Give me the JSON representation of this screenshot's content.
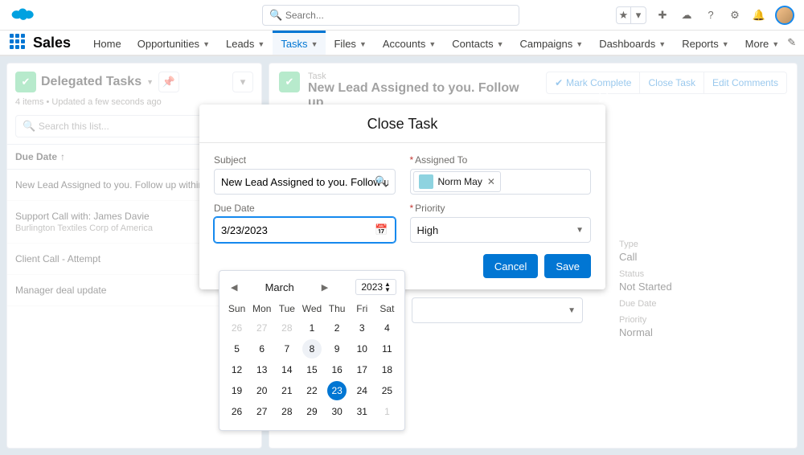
{
  "global": {
    "search_placeholder": "Search...",
    "app_name": "Sales"
  },
  "nav": {
    "items": [
      "Home",
      "Opportunities",
      "Leads",
      "Tasks",
      "Files",
      "Accounts",
      "Contacts",
      "Campaigns",
      "Dashboards",
      "Reports",
      "More"
    ],
    "active": "Tasks"
  },
  "left": {
    "title": "Delegated Tasks",
    "meta": "4 items • Updated a few seconds ago",
    "search_placeholder": "Search this list...",
    "sort_col": "Due Date",
    "rows": [
      {
        "title": "New Lead Assigned to you. Follow up within 2",
        "sub": ""
      },
      {
        "title": "Support Call with: James Davie",
        "sub": "Burlington Textiles Corp of America"
      },
      {
        "title": "Client Call - Attempt",
        "sub": ""
      },
      {
        "title": "Manager deal update",
        "sub": ""
      }
    ]
  },
  "right": {
    "kicker": "Task",
    "title": "New Lead Assigned to you. Follow up",
    "actions": {
      "complete": "Mark Complete",
      "close": "Close Task",
      "edit": "Edit Comments"
    },
    "details": {
      "type_label": "Type",
      "type_val": "Call",
      "status_label": "Status",
      "status_val": "Not Started",
      "due_label": "Due Date",
      "due_val": "",
      "priority_label": "Priority",
      "priority_val": "Normal"
    }
  },
  "modal": {
    "title": "Close Task",
    "close_x": "✕",
    "subject_label": "Subject",
    "subject_val": "New Lead Assigned to you. Follow u",
    "assigned_label": "Assigned To",
    "assigned_name": "Norm May",
    "due_label": "Due Date",
    "due_val": "3/23/2023",
    "priority_label": "Priority",
    "priority_val": "High",
    "cancel": "Cancel",
    "save": "Save"
  },
  "datepicker": {
    "month": "March",
    "year": "2023",
    "dows": [
      "Sun",
      "Mon",
      "Tue",
      "Wed",
      "Thu",
      "Fri",
      "Sat"
    ],
    "cells": [
      {
        "n": "26",
        "m": true
      },
      {
        "n": "27",
        "m": true
      },
      {
        "n": "28",
        "m": true
      },
      {
        "n": "1"
      },
      {
        "n": "2"
      },
      {
        "n": "3"
      },
      {
        "n": "4"
      },
      {
        "n": "5"
      },
      {
        "n": "6"
      },
      {
        "n": "7"
      },
      {
        "n": "8",
        "t": true
      },
      {
        "n": "9"
      },
      {
        "n": "10"
      },
      {
        "n": "11"
      },
      {
        "n": "12"
      },
      {
        "n": "13"
      },
      {
        "n": "14"
      },
      {
        "n": "15"
      },
      {
        "n": "16"
      },
      {
        "n": "17"
      },
      {
        "n": "18"
      },
      {
        "n": "19"
      },
      {
        "n": "20"
      },
      {
        "n": "21"
      },
      {
        "n": "22"
      },
      {
        "n": "23",
        "s": true
      },
      {
        "n": "24"
      },
      {
        "n": "25"
      },
      {
        "n": "26"
      },
      {
        "n": "27"
      },
      {
        "n": "28"
      },
      {
        "n": "29"
      },
      {
        "n": "30"
      },
      {
        "n": "31"
      },
      {
        "n": "1",
        "m": true
      }
    ]
  }
}
